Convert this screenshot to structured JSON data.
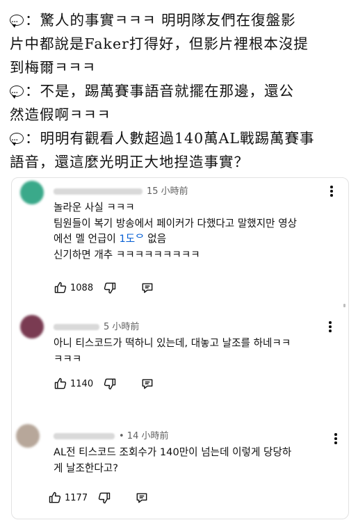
{
  "caption": {
    "lines": [
      "：驚人的事實ㅋㅋㅋ 明明隊友們在復盤影",
      "片中都說是Faker打得好，但影片裡根本沒提",
      "到梅爾ㅋㅋㅋ",
      "：不是，踢萬賽事語音就擺在那邊，還公",
      "然造假啊ㅋㅋㅋ",
      "：明明有觀看人數超過140萬AL戰踢萬賽事",
      "語音，還這麼光明正大地揑造事實？"
    ]
  },
  "comments": [
    {
      "time": "15 小時前",
      "lines": [
        "놀라운 사실 ㅋㅋㅋ",
        "팀원들이 복기 방송에서 페이커가 다했다고 말했지만 영상",
        "에선 멜 언급이 ",
        "신기하면 개추 ㅋㅋㅋㅋㅋㅋㅋㅋㅋ"
      ],
      "link_text": "1도ᄋ",
      "after_link": " 없음",
      "likes": "1088",
      "avatar_color": "#3aa98a"
    },
    {
      "time": "5 小時前",
      "lines": [
        "아니 티스코드가 떡하니 있는데, 대놓고 날조를 하네ㅋㅋ",
        "ㅋㅋㅋ"
      ],
      "likes": "1140",
      "avatar_color": "#7a3b52"
    },
    {
      "time": "• 14 小時前",
      "lines": [
        "AL전 티스코드 조회수가 140만이 넘는데 이렇게 당당하",
        "게 날조한다고?"
      ],
      "likes": "1177",
      "avatar_color": "#b7a79a"
    }
  ],
  "icons": {
    "like": "thumbs-up-icon",
    "dislike": "thumbs-down-icon",
    "reply": "reply-icon",
    "menu": "more-vertical-icon",
    "comment_prefix": "speech-bubble-icon"
  }
}
